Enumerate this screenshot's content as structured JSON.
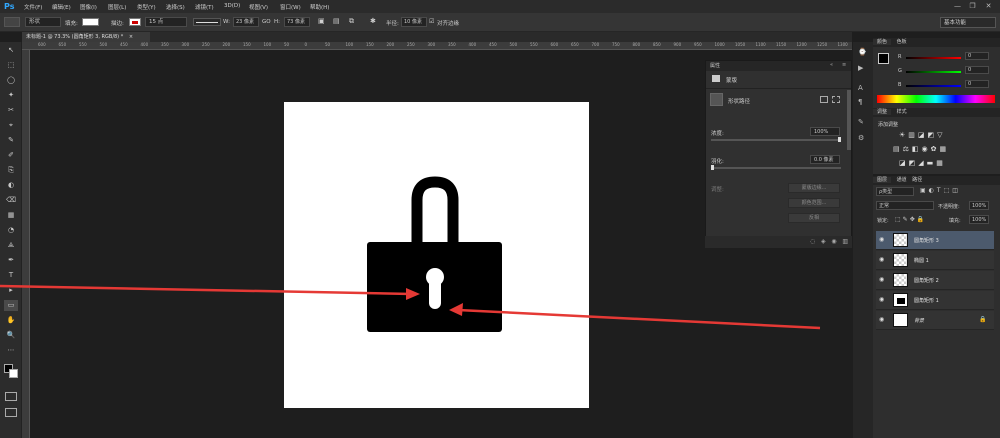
{
  "app": {
    "logo": "Ps"
  },
  "menu": [
    "文件(F)",
    "编辑(E)",
    "图像(I)",
    "图层(L)",
    "类型(Y)",
    "选择(S)",
    "滤镜(T)",
    "3D(D)",
    "视图(V)",
    "窗口(W)",
    "帮助(H)"
  ],
  "window_controls": [
    "—",
    "❐",
    "✕"
  ],
  "options": {
    "mode": "形状",
    "fill_label": "填充:",
    "stroke_label": "描边:",
    "stroke_size": "15 点",
    "w_label": "W:",
    "w_value": "23 像素",
    "link": "GO",
    "h_label": "H:",
    "h_value": "73 像素",
    "radius_label": "半径:",
    "radius_value": "10 像素",
    "align_edges": "对齐边缘",
    "workspace": "基本功能"
  },
  "doc_tab": {
    "title": "未标题-1 @ 73.3% (圆角矩形 3, RGB/8) *",
    "close": "×"
  },
  "ruler_top": [
    "600",
    "650",
    "550",
    "500",
    "450",
    "400",
    "350",
    "300",
    "250",
    "200",
    "150",
    "100",
    "50",
    "0",
    "50",
    "100",
    "150",
    "200",
    "250",
    "300",
    "350",
    "400",
    "450",
    "500",
    "550",
    "600",
    "650",
    "700",
    "750",
    "800",
    "850",
    "900",
    "950",
    "1000",
    "1050",
    "1100",
    "1150",
    "1200",
    "1250",
    "1300"
  ],
  "tools": [
    "↖",
    "⬚",
    "◯",
    "✦",
    "✂",
    "⌖",
    "✎",
    "✐",
    "⎘",
    "◐",
    "⌫",
    "▦",
    "◔",
    "⟁",
    "✒",
    "T",
    "▸",
    "▭",
    "✋",
    "🔍",
    "⋯"
  ],
  "properties": {
    "title": "属性",
    "sub": "蒙版",
    "vector_mask": "形状路径",
    "density_label": "浓度:",
    "density_value": "100%",
    "feather_label": "羽化:",
    "feather_value": "0.0 像素",
    "adjust_label": "调整:",
    "btn_edge": "蒙版边缘...",
    "btn_color": "颜色范围...",
    "btn_invert": "反相"
  },
  "color_panel": {
    "tab1": "颜色",
    "tab2": "色板",
    "r_label": "R",
    "r_value": "0",
    "g_label": "G",
    "g_value": "0",
    "b_label": "B",
    "b_value": "0"
  },
  "adjust_panel": {
    "tab1": "调整",
    "tab2": "样式",
    "title": "添加调整"
  },
  "layers_panel": {
    "tab1": "图层",
    "tab2": "通道",
    "tab3": "路径",
    "kind": "ρ类型",
    "blend": "正常",
    "opacity_label": "不透明度:",
    "opacity_value": "100%",
    "lock_label": "锁定:",
    "fill_label": "填充:",
    "fill_value": "100%",
    "layers": [
      {
        "name": "圆角矩形 3",
        "selected": true
      },
      {
        "name": "椭圆 1",
        "selected": false
      },
      {
        "name": "圆角矩形 2",
        "selected": false
      },
      {
        "name": "圆角矩形 1",
        "selected": false
      },
      {
        "name": "背景",
        "selected": false
      }
    ]
  },
  "colors": {
    "accent": "#31a8ff",
    "arrow": "#e53935",
    "selected_layer": "#4c5a6d"
  }
}
